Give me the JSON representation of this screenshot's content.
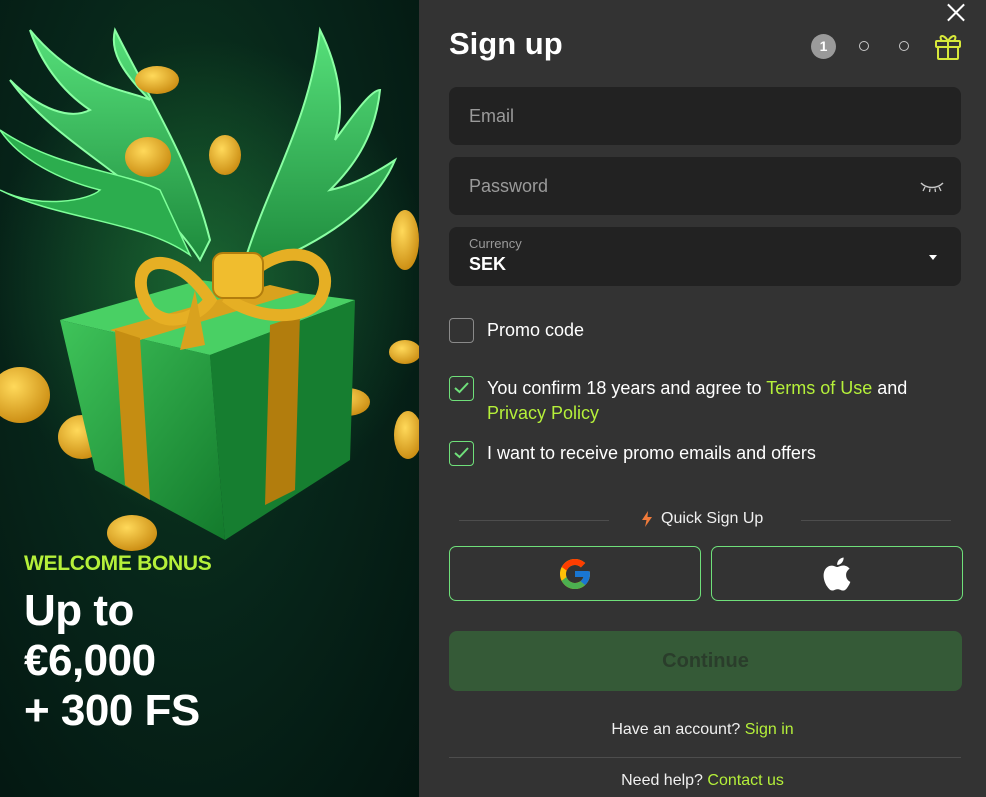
{
  "promo": {
    "tag": "WELCOME BONUS",
    "amount_lines": [
      "Up to",
      "€6,000",
      "+ 300 FS"
    ]
  },
  "colors": {
    "accent": "#b5f03a",
    "checkbox_border": "#6fe07a",
    "continue_bg": "#355a37",
    "panel_bg": "#333333",
    "field_bg": "#222222"
  },
  "form": {
    "title": "Sign up",
    "steps": {
      "active": "1",
      "icons": [
        "step-dot",
        "step-dot",
        "gift-icon"
      ]
    },
    "email_placeholder": "Email",
    "password_placeholder": "Password",
    "currency": {
      "label": "Currency",
      "value": "SEK"
    },
    "promo_code_label": "Promo code",
    "terms": {
      "prefix": "You confirm 18 years and agree to",
      "terms_link": "Terms of Use",
      "and": "and",
      "privacy_link": "Privacy Policy"
    },
    "emails_label": "I want to receive promo emails and offers",
    "quick_signup": "Quick Sign Up",
    "social": [
      "google-icon",
      "apple-icon"
    ],
    "continue_label": "Continue",
    "have_account": "Have an account?",
    "sign_in": "Sign in",
    "need_help": "Need help?",
    "contact_us": "Contact us"
  }
}
